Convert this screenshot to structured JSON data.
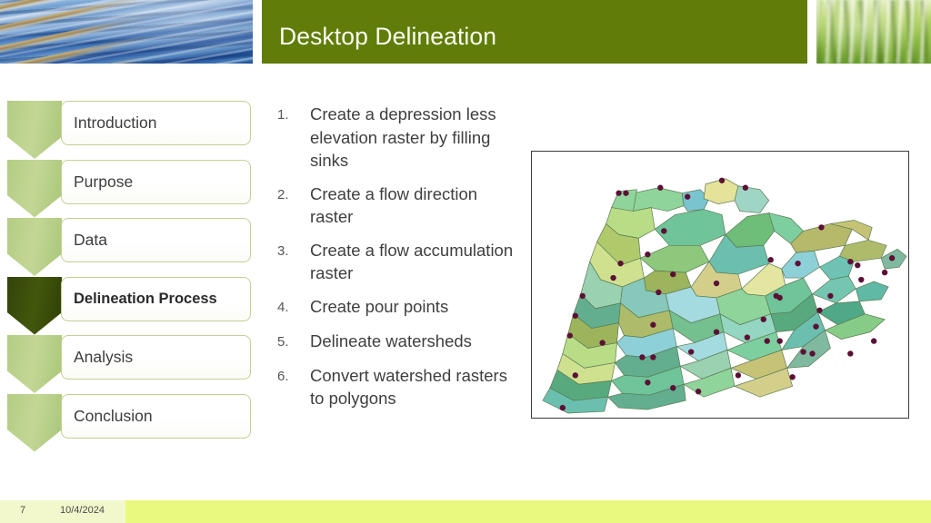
{
  "slide": {
    "title": "Desktop Delineation",
    "slide_number": "7",
    "date": "10/4/2024",
    "accent_olive": "#5f7d08",
    "accent_chevron": "#b3cc83",
    "accent_chevron_active": "#33450a",
    "footer_left_color": "#f3f8cc",
    "footer_right_color": "#e9f97f"
  },
  "decor": {
    "water_image_alt": "water-ripples-photo",
    "grass_image_alt": "green-grass-photo"
  },
  "sidebar": {
    "items": [
      {
        "label": "Introduction",
        "active": false
      },
      {
        "label": "Purpose",
        "active": false
      },
      {
        "label": "Data",
        "active": false
      },
      {
        "label": "Delineation Process",
        "active": true
      },
      {
        "label": "Analysis",
        "active": false
      },
      {
        "label": "Conclusion",
        "active": false
      }
    ]
  },
  "steps": {
    "items": [
      {
        "num": "1.",
        "text": "Create a depression less elevation raster by filling sinks"
      },
      {
        "num": "2.",
        "text": "Create a flow direction raster"
      },
      {
        "num": "3.",
        "text": "Create a flow accumulation raster"
      },
      {
        "num": "4.",
        "text": "Create pour points"
      },
      {
        "num": "5.",
        "text": "Delineate watersheds"
      },
      {
        "num": "6.",
        "text": "Convert watershed rasters to polygons"
      }
    ]
  },
  "map": {
    "caption": "watershed-delineation-map",
    "background": "#ffffff",
    "border_color": "#3a3a3a",
    "polygon_stroke": "#5a7a52",
    "pour_point_color": "#5c1036",
    "palette": [
      "#8fd49a",
      "#7ecfa0",
      "#a8d97e",
      "#b9dd86",
      "#6fc49a",
      "#86c9bb",
      "#9fd5c4",
      "#cfe08f",
      "#e2e6a0",
      "#b0c96a",
      "#9cb45c",
      "#aebb6a",
      "#7fb9a0",
      "#62ae8e",
      "#74c08f",
      "#58a97e",
      "#4fa888",
      "#6bbfae",
      "#93d6c2",
      "#c2dfae",
      "#8dc87d",
      "#6ebd78",
      "#86cc86",
      "#a6d68f",
      "#b6b86a",
      "#c6c377",
      "#d3cf8a",
      "#75c6b0",
      "#5fb9a5",
      "#9ad1b0",
      "#7ac4d0",
      "#8ed0d8",
      "#a4dbe0",
      "#5eb7c4",
      "#6ec3b4"
    ]
  }
}
